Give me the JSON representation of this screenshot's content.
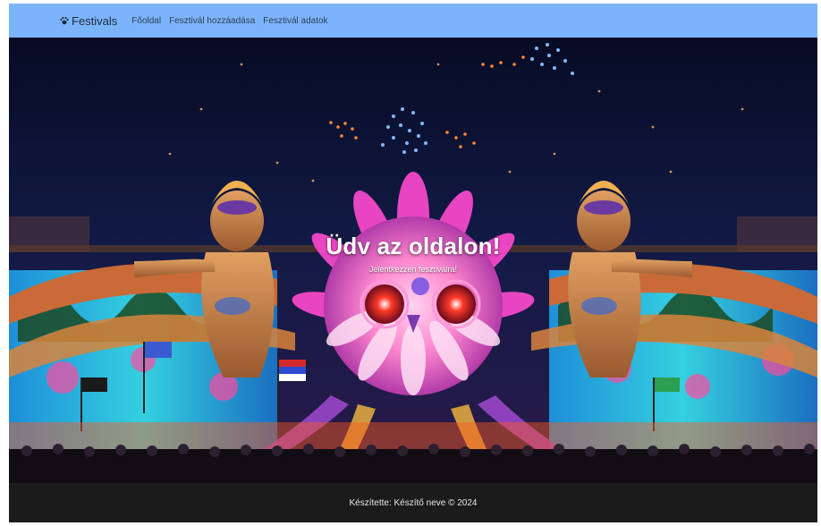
{
  "navbar": {
    "brand_icon": "paw-icon",
    "brand": "Festivals",
    "links": [
      "Főoldal",
      "Fesztivál hozzáadása",
      "Fesztivál adatok"
    ],
    "background": "#7cb4fb"
  },
  "hero": {
    "title": "Üdv az oldalon!",
    "subtitle": "Jelentkezzen fesztiválra!",
    "image": "festival-stage-image"
  },
  "footer": {
    "text": "Készítette: Készítő neve © 2024",
    "background": "#1b1b1b"
  }
}
